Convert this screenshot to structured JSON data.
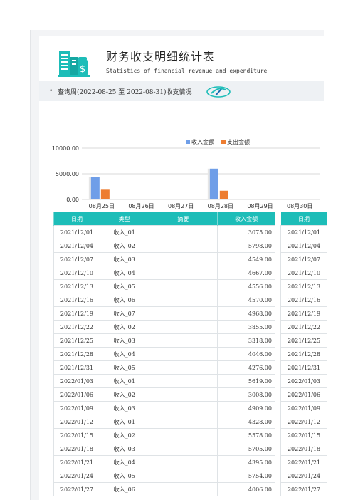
{
  "header": {
    "title": "财务收支明细统计表",
    "subtitle": "Statistics of financial revenue and expenditure"
  },
  "query": {
    "bullet": "•",
    "text": "查询周(2022-08-25 至 2022-08-31)收支情况"
  },
  "chart_data": {
    "type": "bar",
    "categories": [
      "08月25日",
      "08月26日",
      "08月27日",
      "08月28日",
      "08月29日",
      "08月30日"
    ],
    "series": [
      {
        "name": "收入金额",
        "color": "#6f9ee8",
        "values": [
          4400,
          0,
          0,
          6000,
          0,
          0
        ]
      },
      {
        "name": "支出金额",
        "color": "#ed7d31",
        "values": [
          1900,
          0,
          0,
          1700,
          0,
          0
        ]
      }
    ],
    "yticks": [
      "0.00",
      "5000.00",
      "10000.00"
    ],
    "ylim": [
      0,
      10000
    ],
    "legend": "top",
    "grid": true
  },
  "table": {
    "headers": [
      "日期",
      "类型",
      "摘要",
      "收入金额"
    ],
    "rows": [
      {
        "date": "2021/12/01",
        "type": "收入_01",
        "memo": "",
        "amount": "3075.00"
      },
      {
        "date": "2021/12/04",
        "type": "收入_02",
        "memo": "",
        "amount": "5798.00"
      },
      {
        "date": "2021/12/07",
        "type": "收入_03",
        "memo": "",
        "amount": "4549.00"
      },
      {
        "date": "2021/12/10",
        "type": "收入_04",
        "memo": "",
        "amount": "4667.00"
      },
      {
        "date": "2021/12/13",
        "type": "收入_05",
        "memo": "",
        "amount": "4556.00"
      },
      {
        "date": "2021/12/16",
        "type": "收入_06",
        "memo": "",
        "amount": "4570.00"
      },
      {
        "date": "2021/12/19",
        "type": "收入_07",
        "memo": "",
        "amount": "4968.00"
      },
      {
        "date": "2021/12/22",
        "type": "收入_02",
        "memo": "",
        "amount": "3855.00"
      },
      {
        "date": "2021/12/25",
        "type": "收入_03",
        "memo": "",
        "amount": "3318.00"
      },
      {
        "date": "2021/12/28",
        "type": "收入_04",
        "memo": "",
        "amount": "4046.00"
      },
      {
        "date": "2021/12/31",
        "type": "收入_05",
        "memo": "",
        "amount": "4276.00"
      },
      {
        "date": "2022/01/03",
        "type": "收入_01",
        "memo": "",
        "amount": "5619.00"
      },
      {
        "date": "2022/01/06",
        "type": "收入_02",
        "memo": "",
        "amount": "3008.00"
      },
      {
        "date": "2022/01/09",
        "type": "收入_03",
        "memo": "",
        "amount": "4909.00"
      },
      {
        "date": "2022/01/12",
        "type": "收入_01",
        "memo": "",
        "amount": "4328.00"
      },
      {
        "date": "2022/01/15",
        "type": "收入_02",
        "memo": "",
        "amount": "5578.00"
      },
      {
        "date": "2022/01/18",
        "type": "收入_03",
        "memo": "",
        "amount": "5705.00"
      },
      {
        "date": "2022/01/21",
        "type": "收入_04",
        "memo": "",
        "amount": "4395.00"
      },
      {
        "date": "2022/01/24",
        "type": "收入_05",
        "memo": "",
        "amount": "5754.00"
      },
      {
        "date": "2022/01/27",
        "type": "收入_06",
        "memo": "",
        "amount": "4006.00"
      }
    ]
  },
  "date_column": {
    "header": "日期",
    "values": [
      "2021/12/01",
      "2021/12/04",
      "2021/12/07",
      "2021/12/10",
      "2021/12/13",
      "2021/12/16",
      "2021/12/19",
      "2021/12/22",
      "2021/12/25",
      "2021/12/28",
      "2021/12/31",
      "2022/01/03",
      "2022/01/06",
      "2022/01/09",
      "2022/01/12",
      "2022/01/15",
      "2022/01/18",
      "2022/01/21",
      "2022/01/24",
      "2022/01/27"
    ]
  },
  "icons": {
    "logo": "finance-building-dollar-icon",
    "query": "search-swirl-icon"
  },
  "colors": {
    "accent": "#1dbdb8"
  }
}
